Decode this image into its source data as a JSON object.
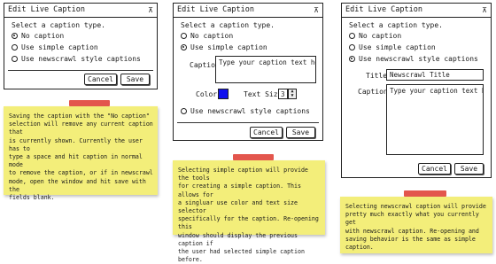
{
  "dialogs": [
    {
      "title": "Edit Live Caption",
      "pin_glyph": "⊼",
      "prompt": "Select a caption type.",
      "options": [
        "No caption",
        "Use simple caption",
        "Use newscrawl style captions"
      ],
      "selected": 0,
      "cancel": "Cancel",
      "save": "Save"
    },
    {
      "title": "Edit Live Caption",
      "pin_glyph": "⊼",
      "prompt": "Select a caption type.",
      "options": [
        "No caption",
        "Use simple caption",
        "Use newscrawl style captions"
      ],
      "selected": 1,
      "caption_label": "Caption:",
      "caption_value": "Type your caption text here.",
      "color_label": "Color:",
      "color_value": "#1010ee",
      "text_size_label": "Text Size:",
      "text_size_value": "3",
      "cancel": "Cancel",
      "save": "Save"
    },
    {
      "title": "Edit Live Caption",
      "pin_glyph": "⊼",
      "prompt": "Select a caption type.",
      "options": [
        "No caption",
        "Use simple caption",
        "Use newscrawl style captions"
      ],
      "selected": 2,
      "title_label": "Title:",
      "title_value": "Newscrawl Title",
      "caption_label": "Caption:",
      "caption_value": "Type your caption text here.",
      "cancel": "Cancel",
      "save": "Save"
    }
  ],
  "notes": [
    {
      "lines": [
        "Saving the caption with the \"No caption\"",
        "selection will remove any current caption that",
        "is currently shown. Currently the user has to",
        "type a space and hit caption in normal mode",
        "to remove the caption, or if in newscrawl",
        "mode, open the window and hit save with the",
        "fields blank."
      ],
      "color": "#f3ee7a",
      "tape_color": "#e0443a"
    },
    {
      "lines": [
        "Selecting simple caption will provide the tools",
        "for creating a simple caption. This allows for",
        "a singluar use color and text size selector",
        "specifically for the caption. Re-opening this",
        "window should display the previous caption if",
        "the user had selected simple caption before."
      ],
      "color": "#f3ee7a",
      "tape_color": "#e0443a"
    },
    {
      "lines": [
        "Selecting newscrawl caption will provide",
        "pretty much exactly what you currently get",
        "with newscrawl caption. Re-opening and",
        "saving behavior is the same as simple caption."
      ],
      "color": "#f3ee7a",
      "tape_color": "#e0443a"
    }
  ]
}
